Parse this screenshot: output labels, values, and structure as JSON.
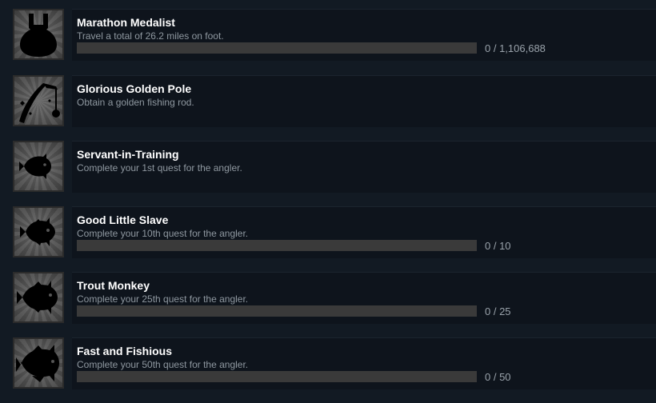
{
  "achievements": [
    {
      "title": "Marathon Medalist",
      "description": "Travel a total of 26.2 miles on foot.",
      "progress_text": "0 / 1,106,688",
      "progress": 0,
      "has_progress": true,
      "icon": "medal-icon"
    },
    {
      "title": "Glorious Golden Pole",
      "description": "Obtain a golden fishing rod.",
      "progress_text": "",
      "progress": 0,
      "has_progress": false,
      "icon": "fishing-rod-icon"
    },
    {
      "title": "Servant-in-Training",
      "description": "Complete your 1st quest for the angler.",
      "progress_text": "",
      "progress": 0,
      "has_progress": false,
      "icon": "small-fish-icon"
    },
    {
      "title": "Good Little Slave",
      "description": "Complete your 10th quest for the angler.",
      "progress_text": "0 / 10",
      "progress": 0,
      "has_progress": true,
      "icon": "fish-icon"
    },
    {
      "title": "Trout Monkey",
      "description": "Complete your 25th quest for the angler.",
      "progress_text": "0 / 25",
      "progress": 0,
      "has_progress": true,
      "icon": "large-fish-icon"
    },
    {
      "title": "Fast and Fishious",
      "description": "Complete your 50th quest for the angler.",
      "progress_text": "0 / 50",
      "progress": 0,
      "has_progress": true,
      "icon": "big-fish-icon"
    }
  ],
  "colors": {
    "background": "#121a23",
    "panel": "#0e141c",
    "bar_track": "#3a3a3a",
    "title": "#ffffff",
    "description": "#8f98a0"
  }
}
